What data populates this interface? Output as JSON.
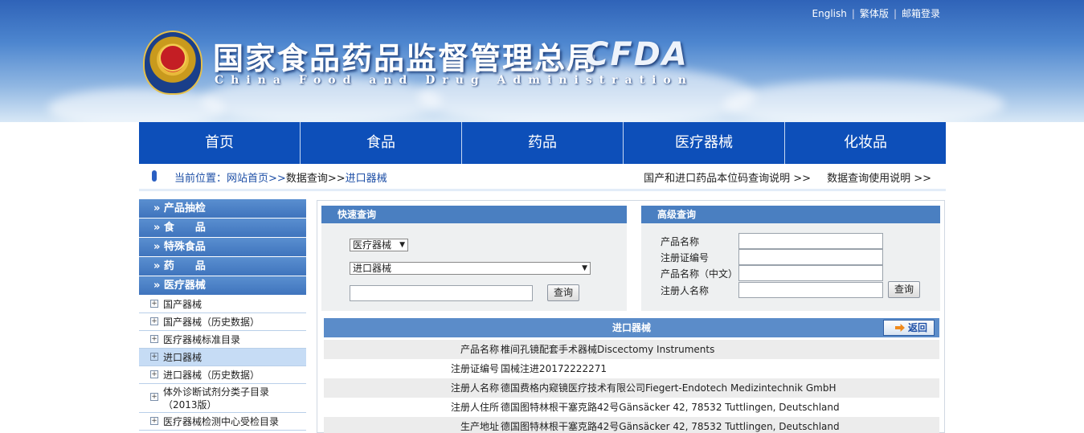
{
  "header": {
    "title_cn": "国家食品药品监督管理总局",
    "title_en": "China Food and Drug Administration",
    "logo_text": "CFDA",
    "links": [
      "English",
      "繁体版",
      "邮箱登录"
    ]
  },
  "nav": [
    "首页",
    "食品",
    "药品",
    "医疗器械",
    "化妆品"
  ],
  "breadcrumb": {
    "prefix": "当前位置：",
    "home": "网站首页>>",
    "query": "数据查询>>",
    "current": "进口器械",
    "right_links": [
      "国产和进口药品本位码查询说明 >>",
      "数据查询使用说明 >>"
    ]
  },
  "sidebar": {
    "sections": [
      "» 产品抽检",
      "» 食　　品",
      "» 特殊食品",
      "» 药　　品",
      "» 医疗器械"
    ],
    "items": [
      "国产器械",
      "国产器械（历史数据）",
      "医疗器械标准目录",
      "进口器械",
      "进口器械（历史数据）",
      "体外诊断试剂分类子目录（2013版）",
      "医疗器械检测中心受检目录"
    ],
    "expand_symbol": "+"
  },
  "quick_search": {
    "title": "快速查询",
    "category": "医疗器械",
    "subcategory": "进口器械",
    "keyword_value": "",
    "button": "查询"
  },
  "advanced_search": {
    "title": "高级查询",
    "fields": [
      "产品名称",
      "注册证编号",
      "产品名称（中文）",
      "注册人名称"
    ],
    "button": "查询"
  },
  "detail": {
    "title": "进口器械",
    "back_label": "返回",
    "rows": [
      {
        "key": "产品名称",
        "value": "椎间孔镜配套手术器械Discectomy Instruments"
      },
      {
        "key": "注册证编号",
        "value": "国械注进20172222271"
      },
      {
        "key": "注册人名称",
        "value": "德国费格内窥镜医疗技术有限公司Fiegert-Endotech Medizintechnik GmbH"
      },
      {
        "key": "注册人住所",
        "value": "德国图特林根干塞克路42号Gänsäcker 42, 78532 Tuttlingen, Deutschland"
      },
      {
        "key": "生产地址",
        "value": "德国图特林根干塞克路42号Gänsäcker 42, 78532 Tuttlingen, Deutschland"
      }
    ]
  },
  "colors": {
    "nav_bg": "#0d4fb9",
    "panel_head": "#4a7fc1",
    "side_head": "#4f84c7",
    "active_item": "#c6dcf5"
  }
}
